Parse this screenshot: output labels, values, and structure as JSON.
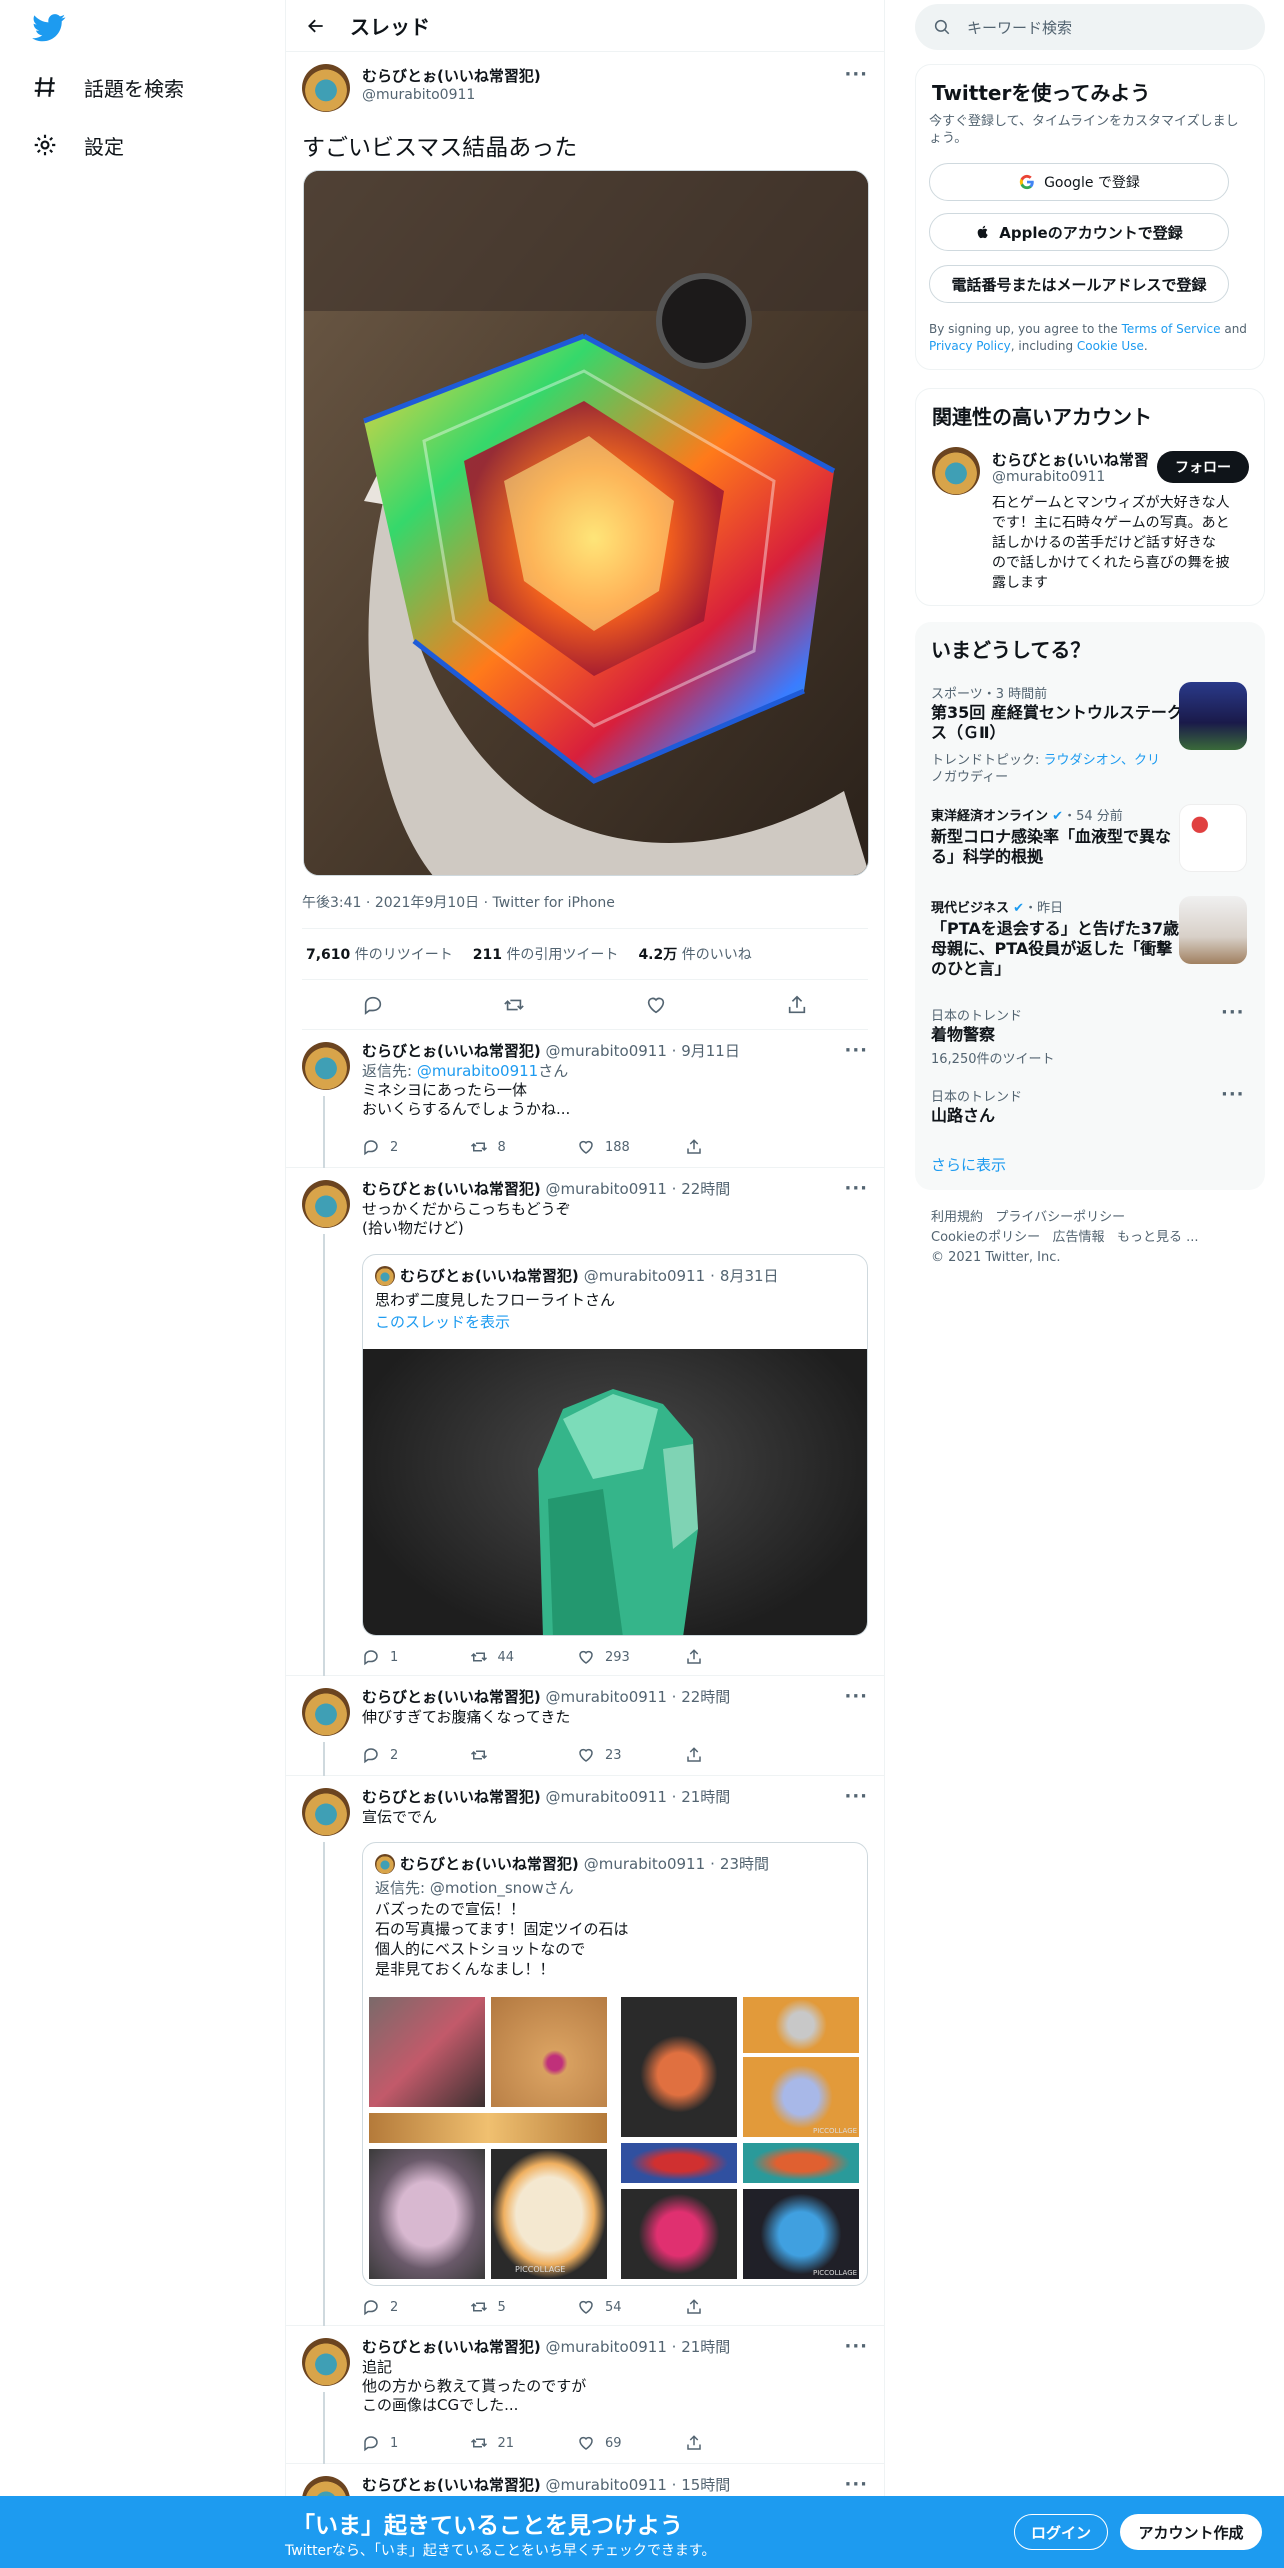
{
  "nav": {
    "explore_label": "話題を検索",
    "settings_label": "設定"
  },
  "header": {
    "title": "スレッド"
  },
  "main_tweet": {
    "name": "むらびとぉ(いいね常習犯)",
    "handle": "@murabito0911",
    "text": "すごいビスマス結晶あった",
    "time": "午後3:41",
    "date": "2021年9月10日",
    "source": "Twitter for iPhone",
    "retweets": "7,610",
    "retweets_label": "件のリツイート",
    "quotes": "211",
    "quotes_label": "件の引用ツイート",
    "likes": "4.2万",
    "likes_label": "件のいいね"
  },
  "replies": [
    {
      "name": "むらびとぉ(いいね常習犯)",
      "handle": "@murabito0911",
      "time": "9月11日",
      "reply_to_prefix": "返信先: ",
      "reply_to": "@murabito0911",
      "reply_to_suffix": "さん",
      "lines": [
        "ミネシヨにあったら一体",
        "おいくらするんでしょうかね..."
      ],
      "reply_count": "2",
      "retweet_count": "8",
      "like_count": "188"
    },
    {
      "name": "むらびとぉ(いいね常習犯)",
      "handle": "@murabito0911",
      "time": "22時間",
      "lines": [
        "せっかくだからこっちもどうぞ",
        "(拾い物だけど)"
      ],
      "quote": {
        "name": "むらびとぉ(いいね常習犯)",
        "handle": "@murabito0911",
        "time": "8月31日",
        "text": "思わず二度見したフローライトさん",
        "link": "このスレッドを表示"
      },
      "reply_count": "1",
      "retweet_count": "44",
      "like_count": "293"
    },
    {
      "name": "むらびとぉ(いいね常習犯)",
      "handle": "@murabito0911",
      "time": "22時間",
      "lines": [
        "伸びすぎてお腹痛くなってきた"
      ],
      "reply_count": "2",
      "retweet_count": "",
      "like_count": "23"
    },
    {
      "name": "むらびとぉ(いいね常習犯)",
      "handle": "@murabito0911",
      "time": "21時間",
      "lines": [
        "宣伝ででん"
      ],
      "quote": {
        "name": "むらびとぉ(いいね常習犯)",
        "handle": "@murabito0911",
        "time": "23時間",
        "reply_to": "返信先: @motion_snowさん",
        "lines": [
          "バズったので宣伝！！",
          "石の写真撮ってます！固定ツイの石は",
          "個人的にベストショットなので",
          "是非見ておくんなまし！！"
        ]
      },
      "reply_count": "2",
      "retweet_count": "5",
      "like_count": "54"
    },
    {
      "name": "むらびとぉ(いいね常習犯)",
      "handle": "@murabito0911",
      "time": "21時間",
      "lines": [
        "追記",
        "他の方から教えて貰ったのですが",
        "この画像はCGでした..."
      ],
      "reply_count": "1",
      "retweet_count": "21",
      "like_count": "69"
    },
    {
      "name": "むらびとぉ(いいね常習犯)",
      "handle": "@murabito0911",
      "time": "15時間"
    }
  ],
  "image_watermarks": [
    "PICCOLLAGE",
    "PICCOLLAGE",
    "PICCOLLAGE"
  ],
  "sidebar": {
    "search_placeholder": "キーワード検索",
    "signup": {
      "title": "Twitterを使ってみよう",
      "subtitle": "今すぐ登録して、タイムラインをカスタマイズしましょう。",
      "google": "Google で登録",
      "apple": "Appleのアカウントで登録",
      "phone": "電話番号またはメールアドレスで登録",
      "terms_prefix": "By signing up, you agree to the ",
      "terms": "Terms of Service",
      "and": " and ",
      "privacy": "Privacy Policy",
      "including": ", including ",
      "cookie": "Cookie Use",
      "period": "."
    },
    "related": {
      "title": "関連性の高いアカウント",
      "name": "むらびとぉ(いいね常習",
      "handle": "@murabito0911",
      "follow": "フォロー",
      "bio": [
        "石とゲームとマンウィズが大好きな人",
        "です！主に石時々ゲームの写真。あと",
        "話しかけるの苦手だけど話す好きな",
        "ので話しかけてくれたら喜びの舞を披",
        "露します"
      ]
    },
    "trends": {
      "title": "いまどうしてる？",
      "items": [
        {
          "meta": "スポーツ・3 時間前",
          "title": [
            "第35回 産経賞セントウルステーク",
            "ス（ＧⅡ）"
          ],
          "extra_prefix": "トレンドトピック: ",
          "extra": [
            "ラウダシオン、クリ",
            "ノガウディー"
          ]
        },
        {
          "source": "東洋経済オンライン",
          "meta": "・54 分前",
          "title": [
            "新型コロナ感染率「血液型で異な",
            "る」科学的根拠"
          ]
        },
        {
          "source": "現代ビジネス",
          "meta": "・昨日",
          "title": [
            "「PTAを退会する」と告げた37歳",
            "母親に、PTA役員が返した「衝撃",
            "のひと言」"
          ]
        },
        {
          "meta": "日本のトレンド",
          "title": [
            "着物警察"
          ],
          "count": "16,250件のツイート"
        },
        {
          "meta": "日本のトレンド",
          "title": [
            "山路さん"
          ]
        }
      ],
      "more": "さらに表示"
    },
    "footer": [
      "利用規約",
      "プライバシーポリシー",
      "Cookieのポリシー",
      "広告情報",
      "もっと見る ...",
      "© 2021 Twitter, Inc."
    ]
  },
  "bottom": {
    "title": "「いま」起きていることを見つけよう",
    "subtitle": "Twitterなら、「いま」起きていることをいち早くチェックできます。",
    "login": "ログイン",
    "signup": "アカウント作成"
  },
  "colors": {
    "accent": "#1d9bf0",
    "text": "#0f1419",
    "muted": "#536471",
    "border": "#eff3f4"
  }
}
